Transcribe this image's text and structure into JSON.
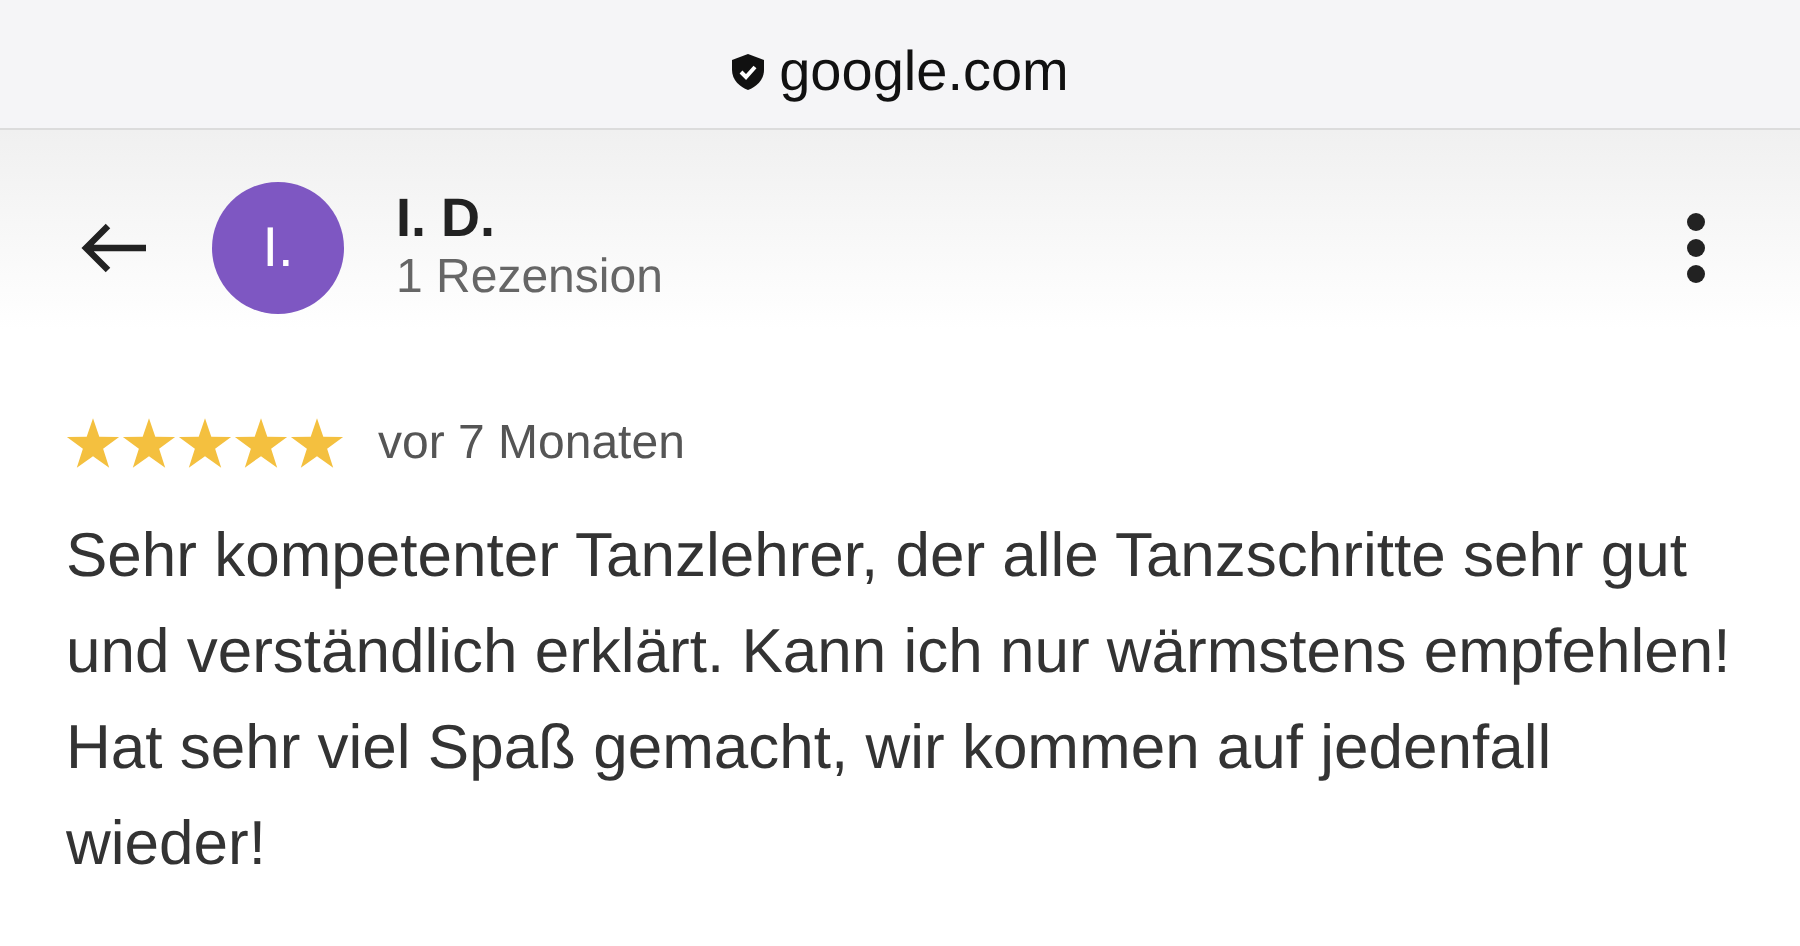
{
  "address_bar": {
    "url": "google.com"
  },
  "reviewer": {
    "initial": "I.",
    "name": "I. D.",
    "review_count": "1 Rezension"
  },
  "review": {
    "stars": 5,
    "time": "vor 7 Monaten",
    "text": "Sehr kompetenter Tanzlehrer, der alle Tanzschritte sehr gut und verständlich erklärt. Kann ich nur wärmstens empfehlen! Hat sehr viel Spaß gemacht, wir kommen auf jedenfall wieder!"
  }
}
